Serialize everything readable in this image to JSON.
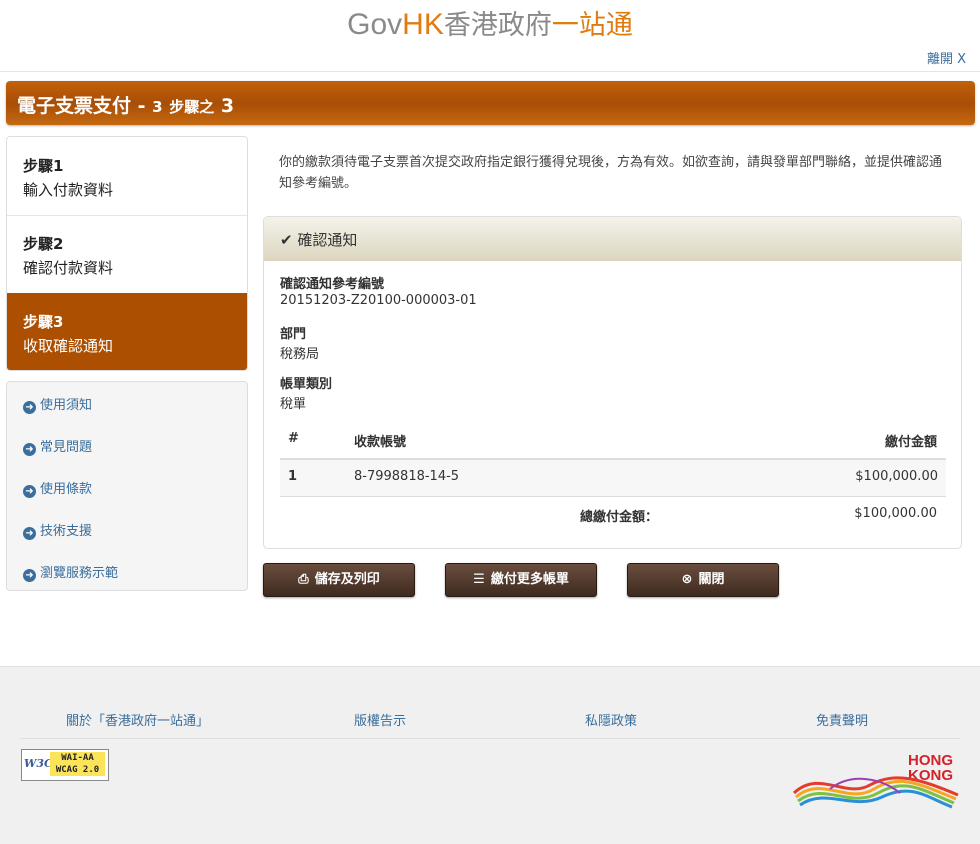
{
  "header": {
    "logo_gov": "Gov",
    "logo_hk": "HK",
    "logo_zh1": "香港政府",
    "logo_zh2": "一站通",
    "leave": "離開 X"
  },
  "title": {
    "main": "電子支票支付 -",
    "step_num": "3",
    "step_text": "步驟之",
    "step_cur": "3"
  },
  "steps": [
    {
      "num": "步驟1",
      "label": "輸入付款資料"
    },
    {
      "num": "步驟2",
      "label": "確認付款資料"
    },
    {
      "num": "步驟3",
      "label": "收取確認通知"
    }
  ],
  "links": [
    "使用須知",
    "常見問題",
    "使用條款",
    "技術支援",
    "瀏覽服務示範"
  ],
  "notice": "你的繳款須待電子支票首次提交政府指定銀行獲得兌現後，方為有效。如欲查詢，請與發單部門聯絡，並提供確認通知參考編號。",
  "panel": {
    "title": "確認通知",
    "ref_label": "確認通知參考編號",
    "ref_value": "20151203-Z20100-000003-01",
    "dept_label": "部門",
    "dept_value": "稅務局",
    "bill_label": "帳單類別",
    "bill_value": "稅單",
    "table": {
      "headers": [
        "#",
        "收款帳號",
        "繳付金額"
      ],
      "rows": [
        [
          "1",
          "8-7998818-14-5",
          "$100,000.00"
        ]
      ],
      "total_label": "總繳付金額：",
      "total_value": "$100,000.00"
    }
  },
  "buttons": {
    "save_print": "儲存及列印",
    "pay_more": "繳付更多帳單",
    "close": "關閉"
  },
  "footer": {
    "links": [
      "關於「香港政府一站通」",
      "版權告示",
      "私隱政策",
      "免責聲明"
    ],
    "w3c": "W3C",
    "wai1": "WAI-AA",
    "wai2": "WCAG 2.0",
    "brand1": "HONG",
    "brand2": "KONG"
  },
  "colors": {
    "accent": "#ad4f00",
    "link": "#3a6e9c",
    "button": "#4a3428"
  }
}
